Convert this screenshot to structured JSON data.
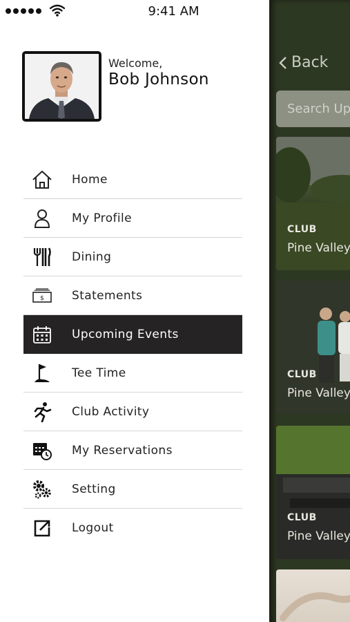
{
  "status": {
    "time": "9:41 AM"
  },
  "profile": {
    "welcome": "Welcome,",
    "name": "Bob Johnson"
  },
  "menu": {
    "items": [
      {
        "label": "Home",
        "icon": "home-icon"
      },
      {
        "label": "My Profile",
        "icon": "profile-icon"
      },
      {
        "label": "Dining",
        "icon": "dining-icon"
      },
      {
        "label": "Statements",
        "icon": "statement-icon"
      },
      {
        "label": "Upcoming Events",
        "icon": "calendar-icon",
        "active": true
      },
      {
        "label": "Tee Time",
        "icon": "golf-flag-icon"
      },
      {
        "label": "Club Activity",
        "icon": "running-icon"
      },
      {
        "label": "My Reservations",
        "icon": "reservation-icon"
      },
      {
        "label": "Setting",
        "icon": "gears-icon"
      },
      {
        "label": "Logout",
        "icon": "logout-icon"
      }
    ]
  },
  "main": {
    "back_label": "Back",
    "search_placeholder": "Search Up",
    "cards": [
      {
        "tag": "CLUB",
        "name": "Pine Valley"
      },
      {
        "tag": "CLUB",
        "name": "Pine Valley"
      },
      {
        "tag": "CLUB",
        "name": "Pine Valley"
      }
    ]
  },
  "colors": {
    "active_bg": "#252323",
    "main_bg": "#2d3822"
  }
}
